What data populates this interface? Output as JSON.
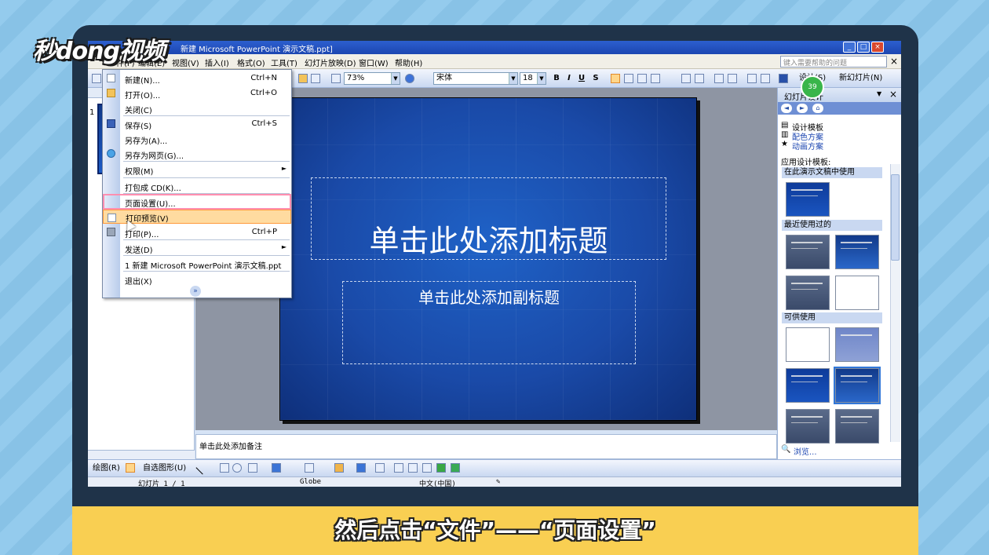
{
  "branding": {
    "logo_text": "秒dong视频"
  },
  "caption": "然后点击“文件”——“页面设置”",
  "window": {
    "title": "新建 Microsoft PowerPoint 演示文稿.ppt]",
    "min": "_",
    "max": "□",
    "close": "×"
  },
  "menubar": {
    "items": [
      "件(F)",
      "编辑(E)",
      "视图(V)",
      "插入(I)",
      "格式(O)",
      "工具(T)",
      "幻灯片放映(D)",
      "窗口(W)",
      "帮助(H)"
    ],
    "help_placeholder": "键入需要帮助的问题",
    "close": "×"
  },
  "toolbar": {
    "zoom": "73%",
    "font": "宋体",
    "font_size": "18",
    "bold": "B",
    "italic": "I",
    "underline": "U",
    "shadow": "S",
    "design_label": "设计(S)",
    "new_slide_label": "新幻灯片(N)"
  },
  "left_pane": {
    "slide_number": "1"
  },
  "slide": {
    "title_placeholder": "单击此处添加标题",
    "subtitle_placeholder": "单击此处添加副标题"
  },
  "notes": {
    "placeholder": "单击此处添加备注"
  },
  "task_pane": {
    "title": "幻灯片设计",
    "links": [
      "设计模板",
      "配色方案",
      "动画方案"
    ],
    "apply_label": "应用设计模板:",
    "sections": [
      "在此演示文稿中使用",
      "最近使用过的",
      "可供使用"
    ],
    "browse": "浏览..."
  },
  "badge": "39",
  "draw_toolbar": {
    "draw_label": "绘图(R)",
    "autoshapes_label": "自选图形(U)"
  },
  "status_bar": {
    "slide": "幻灯片 1 / 1",
    "design": "Globe",
    "language": "中文(中国)"
  },
  "file_menu": {
    "items": [
      {
        "label": "新建(N)...",
        "shortcut": "Ctrl+N"
      },
      {
        "label": "打开(O)...",
        "shortcut": "Ctrl+O"
      },
      {
        "label": "关闭(C)",
        "shortcut": ""
      },
      {
        "label": "保存(S)",
        "shortcut": "Ctrl+S"
      },
      {
        "label": "另存为(A)...",
        "shortcut": ""
      },
      {
        "label": "另存为网页(G)...",
        "shortcut": ""
      },
      {
        "label": "权限(M)",
        "shortcut": ""
      },
      {
        "label": "打包成 CD(K)...",
        "shortcut": ""
      },
      {
        "label": "页面设置(U)...",
        "shortcut": ""
      },
      {
        "label": "打印预览(V)",
        "shortcut": ""
      },
      {
        "label": "打印(P)...",
        "shortcut": "Ctrl+P"
      },
      {
        "label": "发送(D)",
        "shortcut": ""
      },
      {
        "label": "1 新建 Microsoft PowerPoint 演示文稿.ppt",
        "shortcut": ""
      },
      {
        "label": "退出(X)",
        "shortcut": ""
      }
    ]
  },
  "colors": {
    "accent": "#1c46b1",
    "caption_bar": "#f9cf52",
    "highlight_pink": "#ff8fb0",
    "highlight_orange": "#ffdba0"
  }
}
